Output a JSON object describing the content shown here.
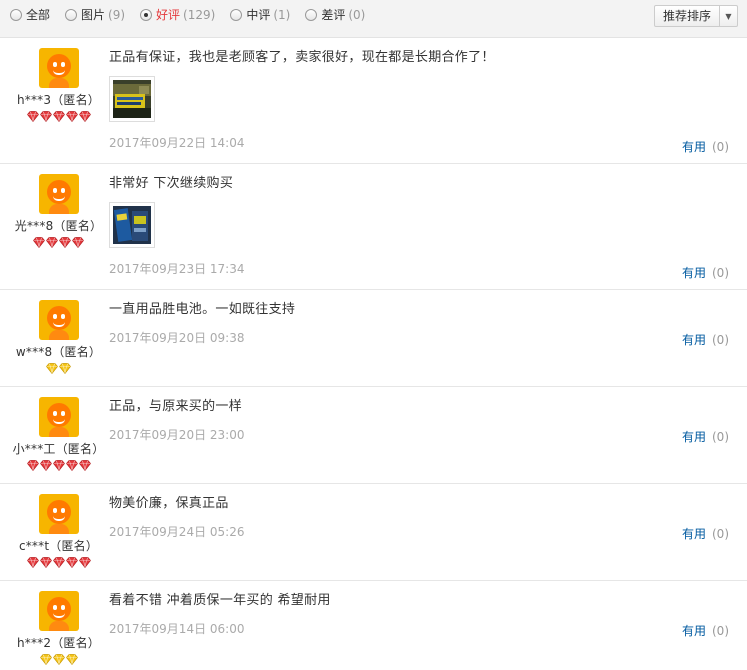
{
  "filters": [
    {
      "label": "全部",
      "count": "",
      "checked": false,
      "active": false
    },
    {
      "label": "图片",
      "count": "(9)",
      "checked": false,
      "active": false
    },
    {
      "label": "好评",
      "count": "(129)",
      "checked": true,
      "active": true
    },
    {
      "label": "中评",
      "count": "(1)",
      "checked": false,
      "active": false
    },
    {
      "label": "差评",
      "count": "(0)",
      "checked": false,
      "active": false
    }
  ],
  "sort": {
    "label": "推荐排序",
    "arrow": "▼"
  },
  "colors": {
    "gem_red": "#e4393c",
    "gem_gold": "#f5c518",
    "useful_blue": "#005aa0",
    "active_red": "#e4393c"
  },
  "reviews": [
    {
      "user": "h***3（匿名）",
      "rank_icon": "red-diamond-icon",
      "rank_count": 5,
      "text": "正品有保证，我也是老顾客了，卖家很好，现在都是长期合作了！",
      "image": "battery-pack-photo",
      "date": "2017年09月22日 14:04",
      "useful_label": "有用",
      "useful_count": "(0)"
    },
    {
      "user": "光***8（匿名）",
      "rank_icon": "red-diamond-icon",
      "rank_count": 4,
      "text": "非常好 下次继续购买",
      "image": "battery-box-photo",
      "date": "2017年09月23日 17:34",
      "useful_label": "有用",
      "useful_count": "(0)"
    },
    {
      "user": "w***8（匿名）",
      "rank_icon": "gold-diamond-icon",
      "rank_count": 2,
      "text": "一直用品胜电池。一如既往支持",
      "image": "",
      "date": "2017年09月20日 09:38",
      "useful_label": "有用",
      "useful_count": "(0)"
    },
    {
      "user": "小***工（匿名）",
      "rank_icon": "red-diamond-icon",
      "rank_count": 5,
      "text": "正品，与原来买的一样",
      "image": "",
      "date": "2017年09月20日 23:00",
      "useful_label": "有用",
      "useful_count": "(0)"
    },
    {
      "user": "c***t（匿名）",
      "rank_icon": "red-diamond-icon",
      "rank_count": 5,
      "text": "物美价廉，保真正品",
      "image": "",
      "date": "2017年09月24日 05:26",
      "useful_label": "有用",
      "useful_count": "(0)"
    },
    {
      "user": "h***2（匿名）",
      "rank_icon": "gold-diamond-icon",
      "rank_count": 3,
      "text": "看着不错 冲着质保一年买的 希望耐用",
      "image": "",
      "date": "2017年09月14日 06:00",
      "useful_label": "有用",
      "useful_count": "(0)"
    }
  ]
}
